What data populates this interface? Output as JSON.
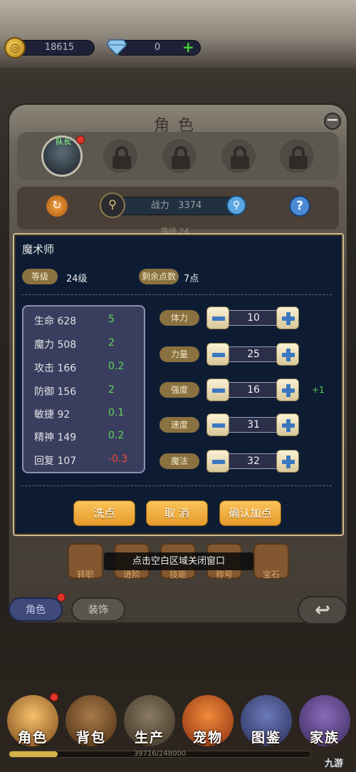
{
  "resources": {
    "gold": "18615",
    "diamonds": "0"
  },
  "character_panel": {
    "title": "角色",
    "avatar_tag": "队长",
    "power_label": "战力",
    "power_value": "3374",
    "level_peek": "等级 24"
  },
  "dialog": {
    "title": "魔术师",
    "level_label": "等级",
    "level_value": "24级",
    "points_label": "剩余点数",
    "points_value": "7点",
    "stats": [
      {
        "name": "生命",
        "value": "628",
        "delta": "5"
      },
      {
        "name": "魔力",
        "value": "508",
        "delta": "2"
      },
      {
        "name": "攻击",
        "value": "166",
        "delta": "0.2"
      },
      {
        "name": "防御",
        "value": "156",
        "delta": "2"
      },
      {
        "name": "敏捷",
        "value": "92",
        "delta": "0.1"
      },
      {
        "name": "精神",
        "value": "149",
        "delta": "0.2"
      },
      {
        "name": "回复",
        "value": "107",
        "delta": "-0.3"
      }
    ],
    "attributes": [
      {
        "label": "体力",
        "value": "10"
      },
      {
        "label": "力量",
        "value": "25"
      },
      {
        "label": "强度",
        "value": "16",
        "bonus": "+1"
      },
      {
        "label": "速度",
        "value": "31"
      },
      {
        "label": "魔法",
        "value": "32"
      }
    ],
    "buttons": {
      "reset": "洗点",
      "cancel": "取 消",
      "confirm": "确认加点"
    }
  },
  "sub_menu": [
    "转职",
    "进阶",
    "技能",
    "称号",
    "宝石"
  ],
  "toast": "点击空白区域关闭窗口",
  "tabs": {
    "character": "角色",
    "decor": "装饰"
  },
  "bottom_nav": [
    "角色",
    "背包",
    "生产",
    "宠物",
    "图鉴",
    "家族"
  ],
  "xp": {
    "text": "39716/248000",
    "fraction": 0.16
  },
  "watermark": "九游",
  "colors": {
    "accent_button": "#e59a2a",
    "positive": "#5fd458",
    "negative": "#ef4a3a",
    "dialog_bg": "#0d1c33"
  }
}
